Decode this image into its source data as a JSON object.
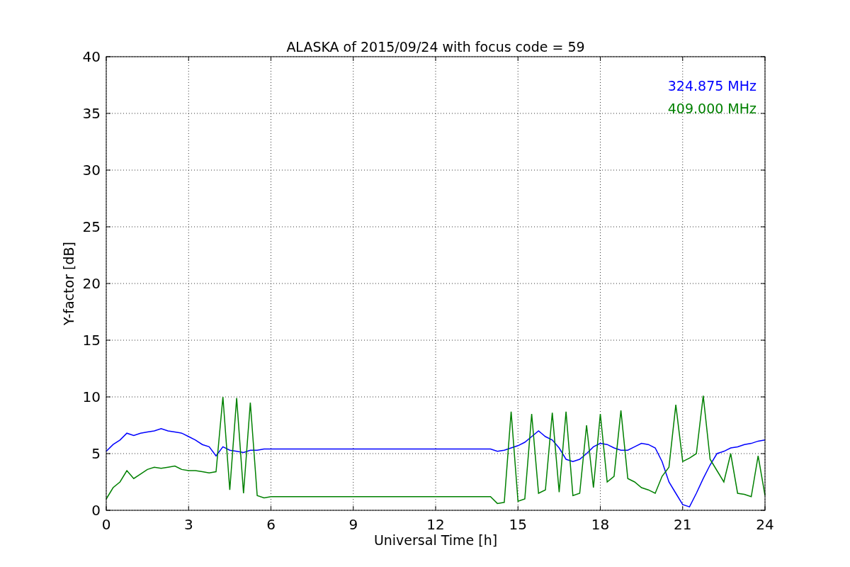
{
  "figure": {
    "chart_data": {
      "type": "line",
      "title": "ALASKA of 2015/09/24 with focus code = 59",
      "xlabel": "Universal Time [h]",
      "ylabel": "Y-factor [dB]",
      "x": [
        0,
        0.25,
        0.5,
        0.75,
        1,
        1.25,
        1.5,
        1.75,
        2,
        2.25,
        2.5,
        2.75,
        3,
        3.25,
        3.5,
        3.75,
        4,
        4.25,
        4.5,
        4.75,
        5,
        5.25,
        5.5,
        5.75,
        6,
        6.25,
        6.5,
        6.75,
        7,
        7.25,
        7.5,
        7.75,
        8,
        8.25,
        8.5,
        8.75,
        9,
        9.25,
        9.5,
        9.75,
        10,
        10.25,
        10.5,
        10.75,
        11,
        11.25,
        11.5,
        11.75,
        12,
        12.25,
        12.5,
        12.75,
        13,
        13.25,
        13.5,
        13.75,
        14,
        14.25,
        14.5,
        14.75,
        15,
        15.25,
        15.5,
        15.75,
        16,
        16.25,
        16.5,
        16.75,
        17,
        17.25,
        17.5,
        17.75,
        18,
        18.25,
        18.5,
        18.75,
        19,
        19.25,
        19.5,
        19.75,
        20,
        20.25,
        20.5,
        20.75,
        21,
        21.25,
        21.5,
        21.75,
        22,
        22.25,
        22.5,
        22.75,
        23,
        23.25,
        23.5,
        23.75,
        24
      ],
      "series": [
        {
          "name": "324.875 MHz",
          "color": "#0000ff",
          "values": [
            5.2,
            5.8,
            6.2,
            6.8,
            6.6,
            6.8,
            6.9,
            7.0,
            7.2,
            7.0,
            6.9,
            6.8,
            6.5,
            6.2,
            5.8,
            5.6,
            4.8,
            5.6,
            5.3,
            5.2,
            5.1,
            5.3,
            5.3,
            5.4,
            5.4,
            5.4,
            5.4,
            5.4,
            5.4,
            5.4,
            5.4,
            5.4,
            5.4,
            5.4,
            5.4,
            5.4,
            5.4,
            5.4,
            5.4,
            5.4,
            5.4,
            5.4,
            5.4,
            5.4,
            5.4,
            5.4,
            5.4,
            5.4,
            5.4,
            5.4,
            5.4,
            5.4,
            5.4,
            5.4,
            5.4,
            5.4,
            5.4,
            5.2,
            5.3,
            5.5,
            5.7,
            6.0,
            6.5,
            7.0,
            6.5,
            6.2,
            5.5,
            4.5,
            4.3,
            4.5,
            5.0,
            5.6,
            5.9,
            5.8,
            5.5,
            5.3,
            5.3,
            5.6,
            5.9,
            5.8,
            5.5,
            4.3,
            2.5,
            1.5,
            0.5,
            0.3,
            1.5,
            2.8,
            4.0,
            5.0,
            5.2,
            5.5,
            5.6,
            5.8,
            5.9,
            6.1,
            6.2
          ]
        },
        {
          "name": "409.000 MHz",
          "color": "#008000",
          "values": [
            1.0,
            2.0,
            2.5,
            3.5,
            2.8,
            3.2,
            3.6,
            3.8,
            3.7,
            3.8,
            3.9,
            3.6,
            3.5,
            3.5,
            3.4,
            3.3,
            3.4,
            10.0,
            1.8,
            9.9,
            1.5,
            9.5,
            1.3,
            1.1,
            1.2,
            1.2,
            1.2,
            1.2,
            1.2,
            1.2,
            1.2,
            1.2,
            1.2,
            1.2,
            1.2,
            1.2,
            1.2,
            1.2,
            1.2,
            1.2,
            1.2,
            1.2,
            1.2,
            1.2,
            1.2,
            1.2,
            1.2,
            1.2,
            1.2,
            1.2,
            1.2,
            1.2,
            1.2,
            1.2,
            1.2,
            1.2,
            1.2,
            0.6,
            0.7,
            8.7,
            0.8,
            1.0,
            8.5,
            1.5,
            1.8,
            8.6,
            1.6,
            8.7,
            1.3,
            1.5,
            7.5,
            2.0,
            8.5,
            2.5,
            3.0,
            8.8,
            2.8,
            2.5,
            2.0,
            1.8,
            1.5,
            3.0,
            3.8,
            9.3,
            4.3,
            4.6,
            5.0,
            10.1,
            4.5,
            3.5,
            2.5,
            5.0,
            1.5,
            1.4,
            1.2,
            4.8,
            1.3
          ]
        }
      ],
      "xlim": [
        0,
        24
      ],
      "ylim": [
        0,
        40
      ],
      "xticks": [
        0,
        3,
        6,
        9,
        12,
        15,
        18,
        21,
        24
      ],
      "yticks": [
        0,
        5,
        10,
        15,
        20,
        25,
        30,
        35,
        40
      ],
      "grid": true
    }
  }
}
